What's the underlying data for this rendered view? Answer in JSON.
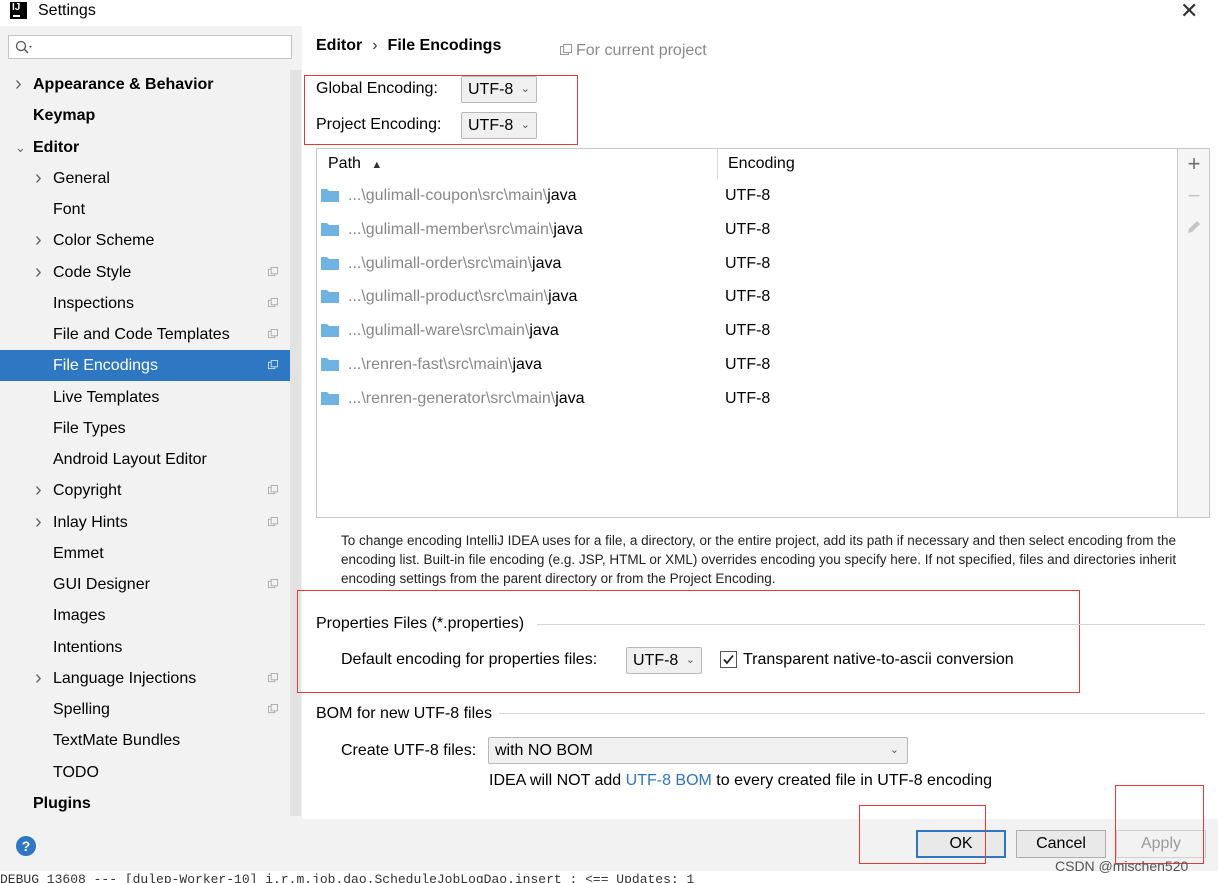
{
  "window": {
    "title": "Settings",
    "close_icon": "close-icon"
  },
  "search": {
    "placeholder": ""
  },
  "sidebar": {
    "items": [
      {
        "label": "Appearance & Behavior",
        "bold": true,
        "arrow": "right"
      },
      {
        "label": "Keymap",
        "bold": true
      },
      {
        "label": "Editor",
        "bold": true,
        "arrow": "down"
      },
      {
        "label": "General",
        "arrow": "right"
      },
      {
        "label": "Font"
      },
      {
        "label": "Color Scheme",
        "arrow": "right"
      },
      {
        "label": "Code Style",
        "arrow": "right",
        "project": true
      },
      {
        "label": "Inspections",
        "project": true
      },
      {
        "label": "File and Code Templates",
        "project": true
      },
      {
        "label": "File Encodings",
        "project": true,
        "selected": true
      },
      {
        "label": "Live Templates"
      },
      {
        "label": "File Types"
      },
      {
        "label": "Android Layout Editor"
      },
      {
        "label": "Copyright",
        "arrow": "right",
        "project": true
      },
      {
        "label": "Inlay Hints",
        "arrow": "right",
        "project": true
      },
      {
        "label": "Emmet"
      },
      {
        "label": "GUI Designer",
        "project": true
      },
      {
        "label": "Images"
      },
      {
        "label": "Intentions"
      },
      {
        "label": "Language Injections",
        "arrow": "right",
        "project": true
      },
      {
        "label": "Spelling",
        "project": true
      },
      {
        "label": "TextMate Bundles"
      },
      {
        "label": "TODO"
      },
      {
        "label": "Plugins",
        "bold": true
      }
    ]
  },
  "breadcrumb": {
    "parent": "Editor",
    "separator": "›",
    "current": "File Encodings",
    "scope": "For current project"
  },
  "global_encoding": {
    "label": "Global Encoding:",
    "value": "UTF-8"
  },
  "project_encoding": {
    "label": "Project Encoding:",
    "value": "UTF-8"
  },
  "table": {
    "columns": {
      "path": "Path",
      "sort_indicator": "▲",
      "encoding": "Encoding"
    },
    "rows": [
      {
        "prefix": "...\\gulimall-coupon\\src\\main\\",
        "leaf": "java",
        "encoding": "UTF-8"
      },
      {
        "prefix": "...\\gulimall-member\\src\\main\\",
        "leaf": "java",
        "encoding": "UTF-8"
      },
      {
        "prefix": "...\\gulimall-order\\src\\main\\",
        "leaf": "java",
        "encoding": "UTF-8"
      },
      {
        "prefix": "...\\gulimall-product\\src\\main\\",
        "leaf": "java",
        "encoding": "UTF-8"
      },
      {
        "prefix": "...\\gulimall-ware\\src\\main\\",
        "leaf": "java",
        "encoding": "UTF-8"
      },
      {
        "prefix": "...\\renren-fast\\src\\main\\",
        "leaf": "java",
        "encoding": "UTF-8"
      },
      {
        "prefix": "...\\renren-generator\\src\\main\\",
        "leaf": "java",
        "encoding": "UTF-8"
      }
    ],
    "toolbar": {
      "add": "+",
      "remove": "−"
    }
  },
  "help_text": "To change encoding IntelliJ IDEA uses for a file, a directory, or the entire project, add its path if necessary and then select encoding from the encoding list. Built-in file encoding (e.g. JSP, HTML or XML) overrides encoding you specify here. If not specified, files and directories inherit encoding settings from the parent directory or from the Project Encoding.",
  "properties": {
    "title": "Properties Files (*.properties)",
    "default_label": "Default encoding for properties files:",
    "default_value": "UTF-8",
    "transparent_label": "Transparent native-to-ascii conversion",
    "transparent_checked": true
  },
  "bom": {
    "title": "BOM for new UTF-8 files",
    "create_label": "Create UTF-8 files:",
    "create_value": "with NO BOM",
    "note_before": "IDEA will NOT add ",
    "note_link": "UTF-8 BOM",
    "note_after": " to every created file in UTF-8 encoding"
  },
  "buttons": {
    "help": "?",
    "ok": "OK",
    "cancel": "Cancel",
    "apply": "Apply"
  },
  "console_text": "DEBUG 13608 --- [dulep-Worker-10] i.r.m.job.dao.ScheduleJobLogDao.insert   : <==    Updates: 1",
  "watermark": "CSDN @mischen520",
  "colors": {
    "selection": "#2d77c3",
    "highlight_box": "#e03a3a",
    "folder": "#6fb3e3",
    "link": "#2f74c0"
  }
}
